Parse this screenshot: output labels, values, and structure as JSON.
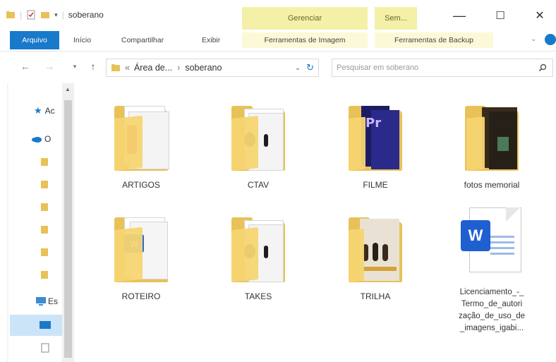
{
  "window": {
    "title": "soberano",
    "minimize_glyph": "—",
    "maximize_glyph": "☐",
    "close_glyph": "✕"
  },
  "context_tabs": {
    "manage": "Gerenciar",
    "sem": "Sem..."
  },
  "ribbon": {
    "file": "Arquivo",
    "home": "Início",
    "share": "Compartilhar",
    "view": "Exibir",
    "image_tools": "Ferramentas de Imagem",
    "backup_tools": "Ferramentas de Backup"
  },
  "address": {
    "segments": [
      "Área de...",
      "soberano"
    ],
    "separator": "›",
    "search_placeholder": "Pesquisar em soberano"
  },
  "nav_pane": {
    "items": [
      {
        "label": "Ac",
        "icon": "star-icon"
      },
      {
        "label": "O",
        "icon": "cloud-icon"
      },
      {
        "label": "",
        "icon": "folder-icon"
      },
      {
        "label": "",
        "icon": "folder-icon"
      },
      {
        "label": "",
        "icon": "folder-icon"
      },
      {
        "label": "",
        "icon": "folder-icon"
      },
      {
        "label": "",
        "icon": "folder-icon"
      },
      {
        "label": "",
        "icon": "folder-icon"
      },
      {
        "label": "Es",
        "icon": "pc-icon"
      }
    ]
  },
  "files": [
    {
      "name": "ARTIGOS",
      "type": "folder",
      "preview": "pdf"
    },
    {
      "name": "CTAV",
      "type": "folder",
      "preview": "video"
    },
    {
      "name": "FILME",
      "type": "folder",
      "preview": "premiere"
    },
    {
      "name": "fotos memorial",
      "type": "folder",
      "preview": "photos"
    },
    {
      "name": "ROTEIRO",
      "type": "folder",
      "preview": "word"
    },
    {
      "name": "TAKES",
      "type": "folder",
      "preview": "video"
    },
    {
      "name": "TRILHA",
      "type": "folder",
      "preview": "poster"
    },
    {
      "name": "Licenciamento_-_Termo_de_autorização_de_uso_de_imagens_igabi...",
      "type": "word-doc",
      "preview": "word",
      "lines": [
        "Licenciamento_-_",
        "Termo_de_autori",
        "zação_de_uso_de",
        "_imagens_igabi..."
      ]
    }
  ],
  "colors": {
    "accent": "#1979ca",
    "folder": "#f6d572",
    "context": "#f4f0a8"
  }
}
